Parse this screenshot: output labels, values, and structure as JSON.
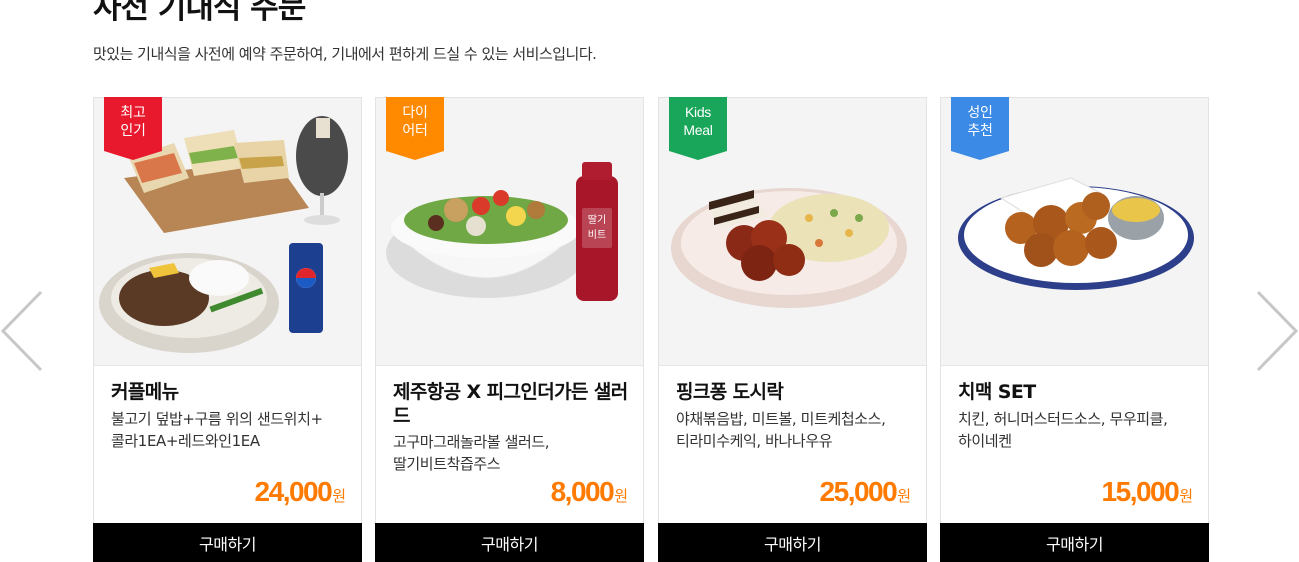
{
  "header": {
    "title": "사전 기내식 주문",
    "description": "맛있는 기내식을 사전에 예약 주문하여, 기내에서 편하게 드실 수 있는 서비스입니다."
  },
  "navigation": {
    "prev_icon": "chevron-left-icon",
    "next_icon": "chevron-right-icon",
    "arrow_color": "#c7c7c7"
  },
  "products": [
    {
      "badge": "최고\n인기",
      "badge_color": "#e8192c",
      "name": "커플메뉴",
      "items": "불고기 덮밥+구름 위의 샌드위치+\n콜라1EA+레드와인1EA",
      "price": "24,000",
      "currency": "원",
      "buy_label": "구매하기"
    },
    {
      "badge": "다이\n어터",
      "badge_color": "#ff8a00",
      "name": "제주항공 X 피그인더가든 샐러드",
      "items": "고구마그래놀라볼 샐러드,\n딸기비트착즙주스",
      "price": "8,000",
      "currency": "원",
      "buy_label": "구매하기"
    },
    {
      "badge": "Kids\nMeal",
      "badge_color": "#1aa65a",
      "name": "핑크퐁 도시락",
      "items": "야채볶음밥, 미트볼, 미트케첩소스,\n티라미수케익, 바나나우유",
      "price": "25,000",
      "currency": "원",
      "buy_label": "구매하기"
    },
    {
      "badge": "성인\n추천",
      "badge_color": "#3a8ae6",
      "name": "치맥 SET",
      "items": "치킨, 허니머스터드소스, 무우피클,\n하이네켄",
      "price": "15,000",
      "currency": "원",
      "buy_label": "구매하기"
    }
  ],
  "colors": {
    "price": "#ff7a00",
    "button_bg": "#000000",
    "button_text": "#ffffff"
  }
}
